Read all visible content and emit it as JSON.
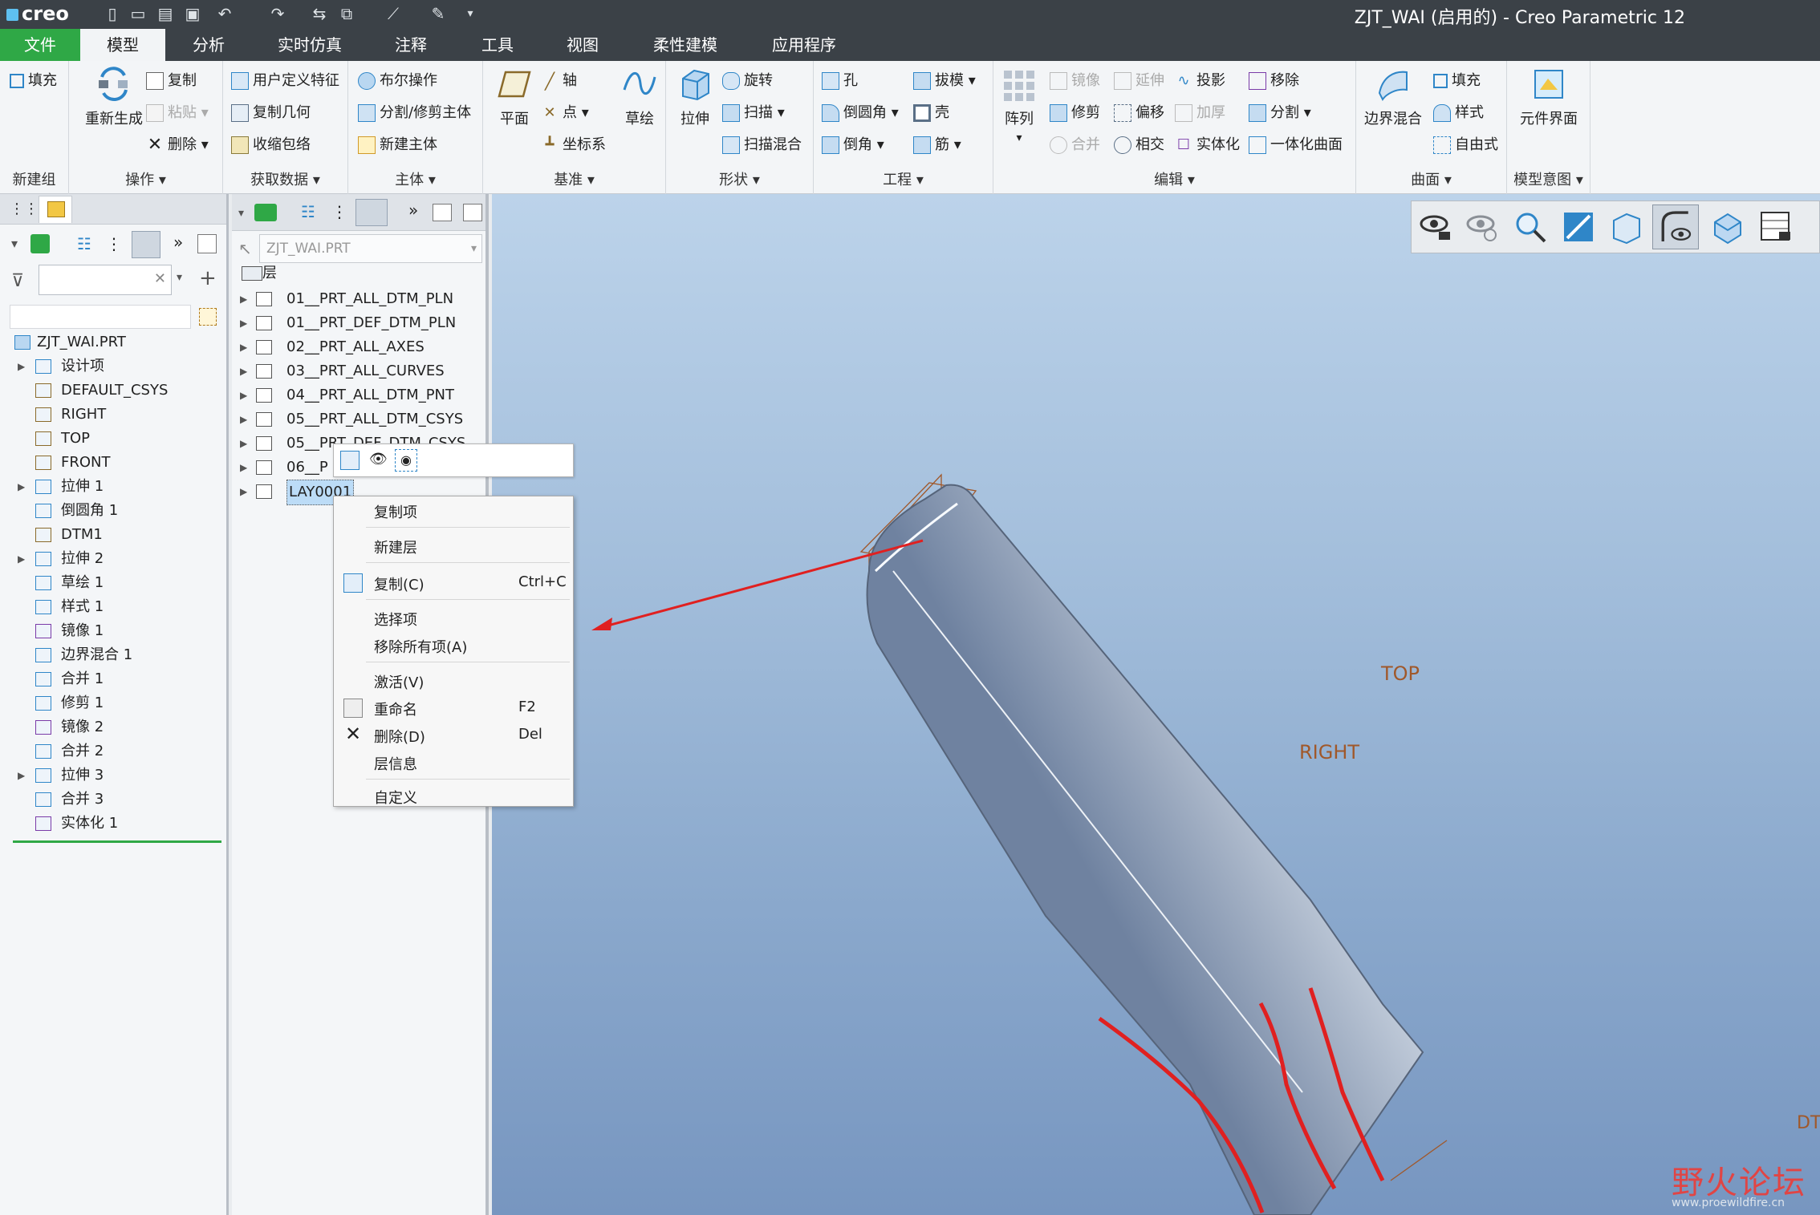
{
  "window": {
    "title": "ZJT_WAI (启用的) - Creo Parametric 12",
    "logo": "creo"
  },
  "menu": {
    "items": [
      "文件",
      "模型",
      "分析",
      "实时仿真",
      "注释",
      "工具",
      "视图",
      "柔性建模",
      "应用程序"
    ]
  },
  "ribbon": {
    "groups": {
      "new_group": "新建组",
      "operations": "操作",
      "get_data": "获取数据",
      "body": "主体",
      "datum": "基准",
      "shapes": "形状",
      "engineering": "工程",
      "editing": "编辑",
      "surfaces": "曲面",
      "model_intent": "模型意图"
    },
    "buttons": {
      "fill_a": "填充",
      "regenerate": "重新生成",
      "copy": "复制",
      "paste": "粘贴",
      "delete": "删除",
      "udf": "用户定义特征",
      "copy_geom": "复制几何",
      "shrinkwrap": "收缩包络",
      "boolean": "布尔操作",
      "split_body": "分割/修剪主体",
      "new_body": "新建主体",
      "plane": "平面",
      "axis": "轴",
      "point": "点",
      "csys": "坐标系",
      "sketch": "草绘",
      "extrude": "拉伸",
      "revolve": "旋转",
      "sweep": "扫描",
      "swept_blend": "扫描混合",
      "hole": "孔",
      "round": "倒圆角",
      "chamfer": "倒角",
      "draft": "拔模",
      "shell": "壳",
      "rib": "筋",
      "pattern": "阵列",
      "mirror": "镜像",
      "extend": "延伸",
      "project": "投影",
      "trim": "修剪",
      "offset": "偏移",
      "thicken": "加厚",
      "merge": "合并",
      "intersect": "相交",
      "solidify": "实体化",
      "remove": "移除",
      "split": "分割",
      "unify_quilts": "一体化曲面",
      "boundary_blend": "边界混合",
      "fill_b": "填充",
      "style": "样式",
      "freestyle": "自由式",
      "component_interface": "元件界面"
    }
  },
  "model_tree": {
    "root": "ZJT_WAI.PRT",
    "items": [
      "设计项",
      "DEFAULT_CSYS",
      "RIGHT",
      "TOP",
      "FRONT",
      "拉伸 1",
      "倒圆角 1",
      "DTM1",
      "拉伸 2",
      "草绘 1",
      "样式 1",
      "镜像 1",
      "边界混合 1",
      "合并 1",
      "修剪 1",
      "镜像 2",
      "合并 2",
      "拉伸 3",
      "合并 3",
      "实体化 1"
    ]
  },
  "layer_tree": {
    "model_select": "ZJT_WAI.PRT",
    "header": "层",
    "layers": [
      "01__PRT_ALL_DTM_PLN",
      "01__PRT_DEF_DTM_PLN",
      "02__PRT_ALL_AXES",
      "03__PRT_ALL_CURVES",
      "04__PRT_ALL_DTM_PNT",
      "05__PRT_ALL_DTM_CSYS",
      "05__PRT_DEF_DTM_CSYS",
      "06__P",
      "LAY0001"
    ]
  },
  "context_menu": {
    "copy_items": "复制项",
    "new_layer": "新建层",
    "copy": "复制(C)",
    "copy_shortcut": "Ctrl+C",
    "select_items": "选择项",
    "remove_all": "移除所有项(A)",
    "activate": "激活(V)",
    "rename": "重命名",
    "rename_shortcut": "F2",
    "delete": "删除(D)",
    "delete_shortcut": "Del",
    "layer_info": "层信息",
    "customize": "自定义"
  },
  "viewport": {
    "datum_top": "TOP",
    "datum_right": "RIGHT",
    "datum_dtm": "DT",
    "watermark": "野火论坛",
    "watermark_sub": "www.proewildfire.cn"
  },
  "colors": {
    "file_tab": "#2fa846",
    "menubar": "#3b4147",
    "accent_red": "#e02020",
    "datum_label": "#a0582a"
  }
}
